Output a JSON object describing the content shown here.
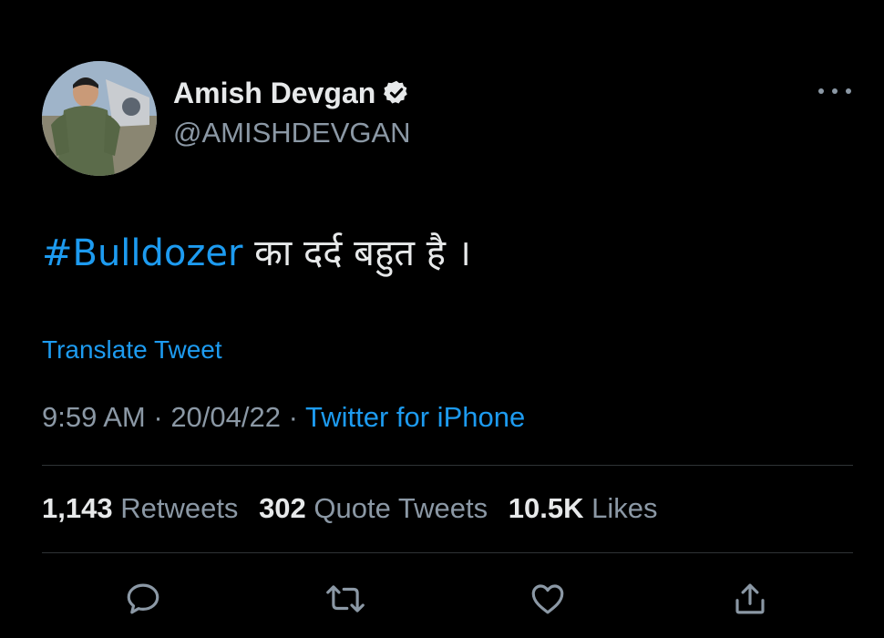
{
  "author": {
    "display_name": "Amish Devgan",
    "handle": "@AMISHDEVGAN",
    "verified": true
  },
  "tweet": {
    "hashtag": "#Bulldozer",
    "text": " का दर्द बहुत है ।",
    "translate_label": "Translate Tweet"
  },
  "meta": {
    "time": "9:59 AM",
    "separator": " · ",
    "date": "20/04/22",
    "source": "Twitter for iPhone"
  },
  "stats": {
    "retweets_count": "1,143",
    "retweets_label": "Retweets",
    "quotes_count": "302",
    "quotes_label": "Quote Tweets",
    "likes_count": "10.5K",
    "likes_label": "Likes"
  },
  "actions": [
    "reply-icon",
    "retweet-icon",
    "like-icon",
    "share-icon"
  ],
  "colors": {
    "background": "#000000",
    "text": "#e7e9ea",
    "secondary": "#8b98a5",
    "accent": "#1d9bf0",
    "divider": "#2f3336"
  }
}
